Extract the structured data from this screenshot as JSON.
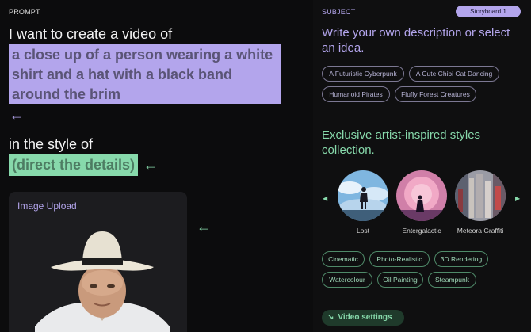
{
  "prompt": {
    "section_label": "PROMPT",
    "line1": "I want to create a video of",
    "subject_text": "a close up of a person wearing a white shirt and a hat with a black band around the brim",
    "line2": "in the style of",
    "style_text": "(direct the details)",
    "upload_title": "Image Upload"
  },
  "subject": {
    "section_label": "SUBJECT",
    "storyboard_label": "Storyboard 1",
    "heading": "Write your own description or select an idea.",
    "ideas": [
      "A Futuristic Cyberpunk",
      "A Cute Chibi Cat Dancing",
      "Humanoid Pirates",
      "Fluffy Forest Creatures"
    ]
  },
  "styles": {
    "heading": "Exclusive artist-inspired styles collection.",
    "featured": [
      "Lost",
      "Entergalactic",
      "Meteora Graffiti"
    ],
    "chips": [
      "Cinematic",
      "Photo-Realistic",
      "3D Rendering",
      "Watercolour",
      "Oil Painting",
      "Steampunk"
    ]
  },
  "video_settings_label": "Video settings",
  "icons": {
    "arrow_left": "←",
    "carousel_prev": "◀",
    "carousel_next": "▶",
    "video_settings": "↘"
  },
  "colors": {
    "background": "#0c0c0d",
    "accent_purple": "#b3a5ec",
    "accent_green": "#87d9ab",
    "card": "#1c1c1f"
  }
}
